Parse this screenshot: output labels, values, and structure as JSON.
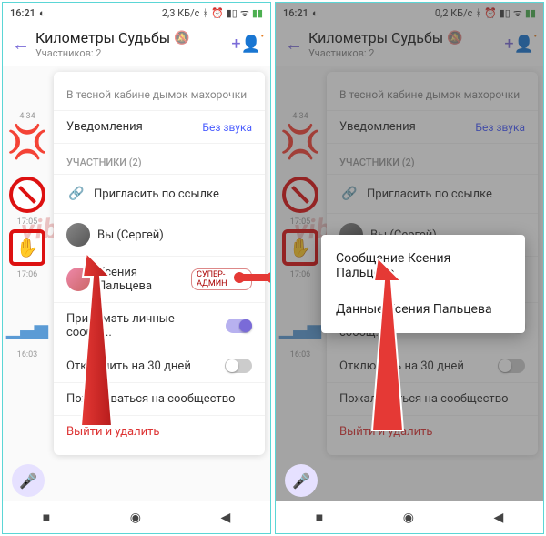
{
  "status": {
    "time": "16:21",
    "net_left": "2,3 КБ/с",
    "net_right": "0,2 КБ/с"
  },
  "header": {
    "title": "Километры Судьбы",
    "subtitle": "Участников: 2"
  },
  "snippet": "В тесной кабине дымок махорочки",
  "notifications": {
    "label": "Уведомления",
    "value": "Без звука"
  },
  "participants_header": "УЧАСТНИКИ (2)",
  "invite": "Пригласить по ссылке",
  "members": {
    "you": "Вы (Сергей)",
    "kseniya": "Ксения Пальцева",
    "badge": "СУПЕР-АДМИН"
  },
  "settings": {
    "pm": "Принимать личные сообщения",
    "pm_short": "Принимать личные сообщ...",
    "disable30": "Отключить на 30 дней",
    "disable30_short": "Отключить на 30 дней",
    "report": "Пожаловаться на сообщество",
    "leave": "Выйти и удалить"
  },
  "popup": {
    "msg": "Сообщение Ксения Пальцева",
    "info": "Данные Ксения Пальцева"
  },
  "times": {
    "t1": "4:34",
    "t2": "17:05",
    "t3": "17:06",
    "t4": "16:03"
  },
  "watermark": "viberFAQ.ru"
}
